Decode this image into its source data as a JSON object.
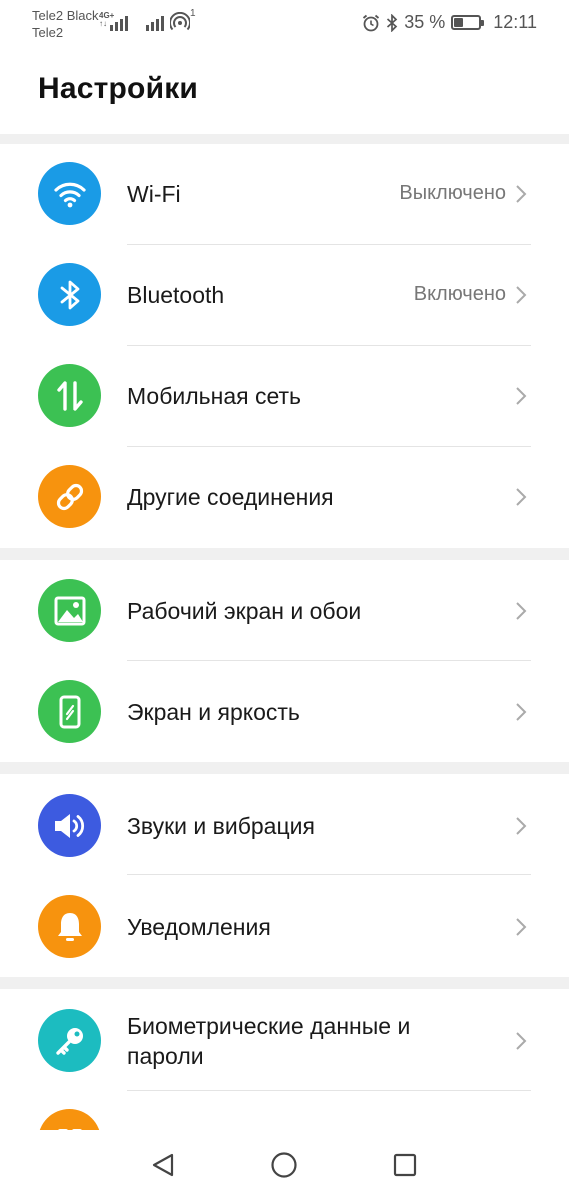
{
  "status": {
    "carrier1": "Tele2 Black",
    "carrier2": "Tele2",
    "net_type_top": "4G+",
    "net_type_bottom": "↑↓",
    "hotspot_count": "1",
    "battery_percent": "35 %",
    "battery_level": 0.35,
    "time": "12:11"
  },
  "title": "Настройки",
  "items": [
    {
      "label": "Wi-Fi",
      "value": "Выключено",
      "icon": "wifi-icon",
      "color": "#1a9be6"
    },
    {
      "label": "Bluetooth",
      "value": "Включено",
      "icon": "bluetooth-icon",
      "color": "#1a9be6"
    },
    {
      "label": "Мобильная сеть",
      "value": "",
      "icon": "mobile-data-icon",
      "color": "#3cc153"
    },
    {
      "label": "Другие соединения",
      "value": "",
      "icon": "link-icon",
      "color": "#f7930e"
    },
    {
      "label": "Рабочий экран и обои",
      "value": "",
      "icon": "wallpaper-icon",
      "color": "#3cc153"
    },
    {
      "label": "Экран и яркость",
      "value": "",
      "icon": "display-icon",
      "color": "#3cc153"
    },
    {
      "label": "Звуки и вибрация",
      "value": "",
      "icon": "sound-icon",
      "color": "#3d5be0"
    },
    {
      "label": "Уведомления",
      "value": "",
      "icon": "bell-icon",
      "color": "#f7930e"
    },
    {
      "label": "Биометрические данные и",
      "label2": "пароли",
      "value": "",
      "icon": "key-icon",
      "color": "#1cbcc0"
    },
    {
      "label": "",
      "value": "",
      "icon": "apps-icon",
      "color": "#f7930e"
    }
  ]
}
